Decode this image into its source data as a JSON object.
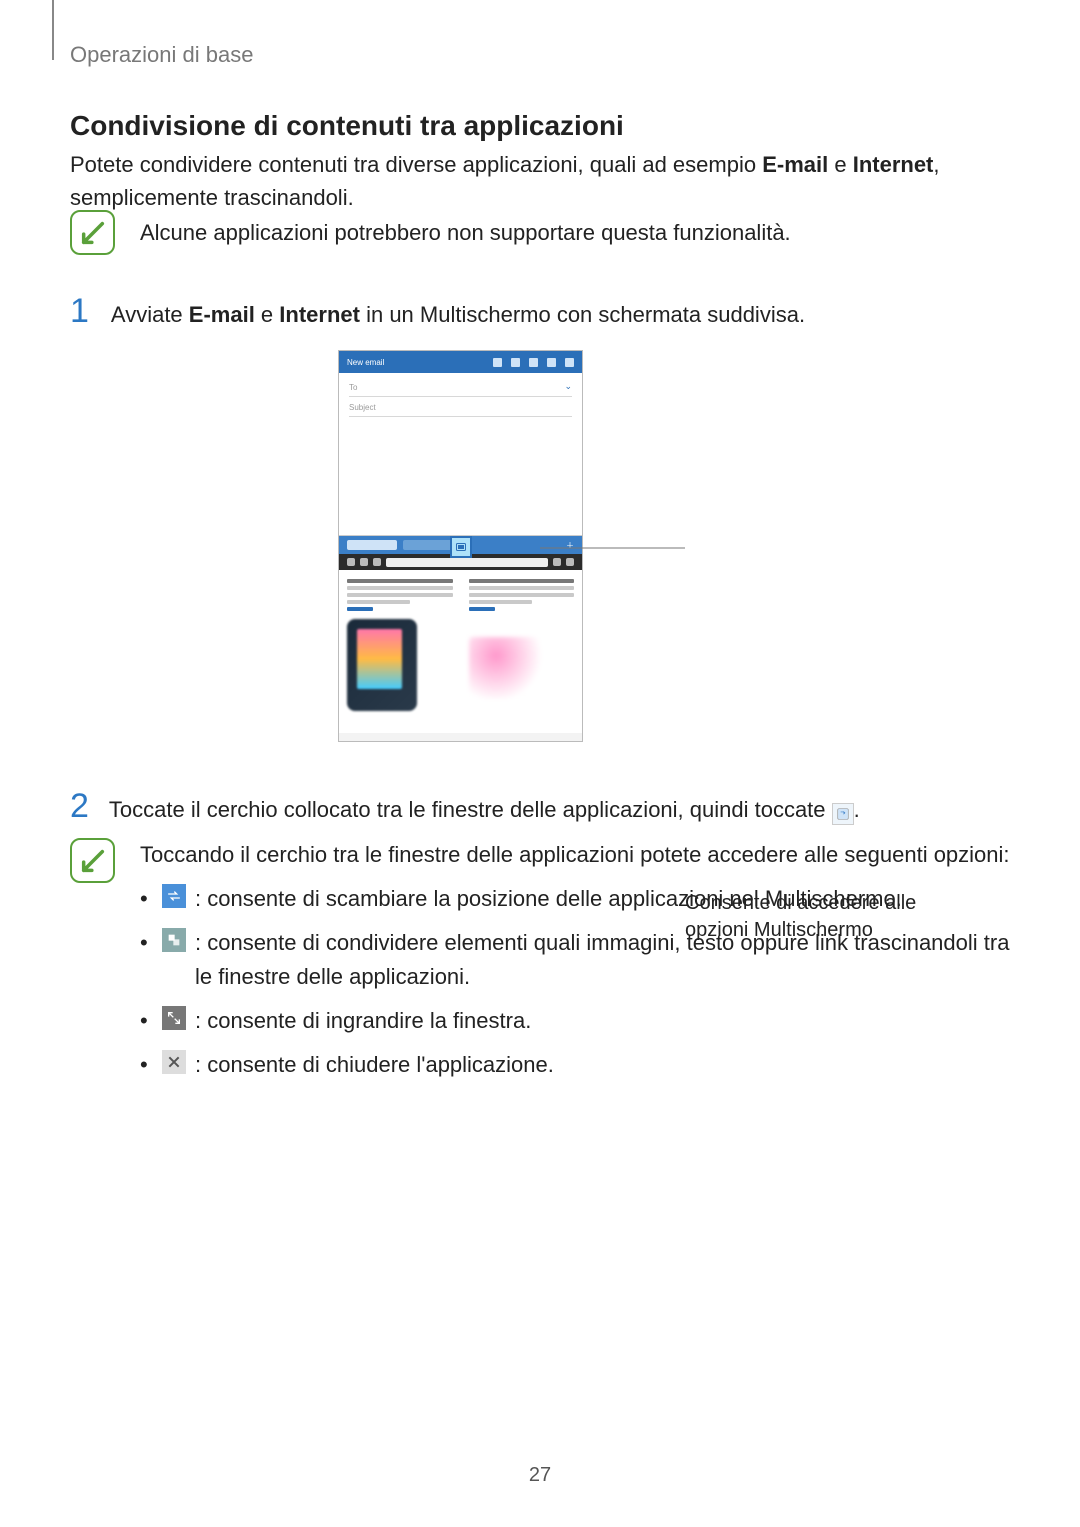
{
  "header": "Operazioni di base",
  "section_title": "Condivisione di contenuti tra applicazioni",
  "intro": {
    "part1": "Potete condividere contenuti tra diverse applicazioni, quali ad esempio ",
    "b1": "E-mail",
    "mid": " e ",
    "b2": "Internet",
    "part2": ", semplicemente trascinandoli."
  },
  "note1": "Alcune applicazioni potrebbero non supportare questa funzionalità.",
  "step1": {
    "num": "1",
    "pre": "Avviate ",
    "b1": "E-mail",
    "mid": " e ",
    "b2": "Internet",
    "post": " in un Multischermo con schermata suddivisa."
  },
  "figure": {
    "email_title": "New email",
    "to": "To",
    "subject": "Subject"
  },
  "callout": "Consente di accedere alle opzioni Multischermo",
  "step2": {
    "num": "2",
    "pre": "Toccate il cerchio collocato tra le finestre delle applicazioni, quindi toccate ",
    "post": "."
  },
  "note2_intro": "Toccando il cerchio tra le finestre delle applicazioni potete accedere alle seguenti opzioni:",
  "bullets": {
    "swap": " : consente di scambiare la posizione delle applicazioni nel Multischermo.",
    "share": " : consente di condividere elementi quali immagini, testo oppure link trascinandoli tra le finestre delle applicazioni.",
    "expand": " : consente di ingrandire la finestra.",
    "close": " : consente di chiudere l'applicazione."
  },
  "page_number": "27"
}
